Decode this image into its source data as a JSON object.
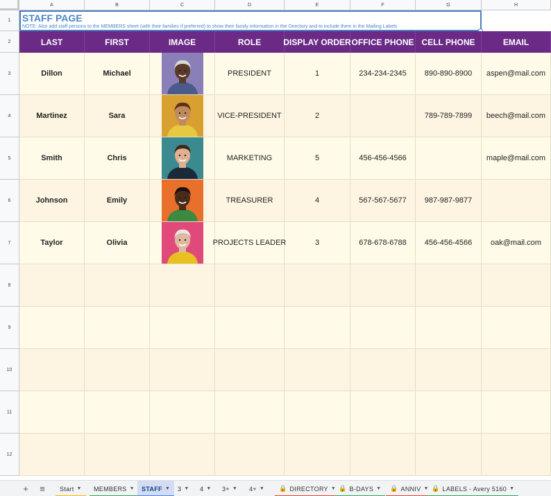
{
  "columns": [
    "A",
    "B",
    "C",
    "D",
    "E",
    "F",
    "G",
    "H"
  ],
  "rows": [
    "1",
    "2",
    "3",
    "4",
    "5",
    "6",
    "7",
    "8",
    "9",
    "10",
    "11",
    "12"
  ],
  "title": "STAFF PAGE",
  "note": "NOTE: Also add staff persons to the MEMBERS sheet (with their families if preferred) to show their family information in the Directory and to include them in the Mailing Labels",
  "headers": [
    "LAST",
    "FIRST",
    "IMAGE",
    "ROLE",
    "DISPLAY ORDER",
    "OFFICE PHONE",
    "CELL PHONE",
    "EMAIL"
  ],
  "staff": [
    {
      "last": "Dillon",
      "first": "Michael",
      "role": "PRESIDENT",
      "order": "1",
      "office": "234-234-2345",
      "cell": "890-890-8900",
      "email": "aspen@mail.com"
    },
    {
      "last": "Martinez",
      "first": "Sara",
      "role": "VICE-PRESIDENT",
      "order": "2",
      "office": "",
      "cell": "789-789-7899",
      "email": "beech@mail.com"
    },
    {
      "last": "Smith",
      "first": "Chris",
      "role": "MARKETING",
      "order": "5",
      "office": "456-456-4566",
      "cell": "",
      "email": "maple@mail.com"
    },
    {
      "last": "Johnson",
      "first": "Emily",
      "role": "TREASURER",
      "order": "4",
      "office": "567-567-5677",
      "cell": "987-987-9877",
      "email": ""
    },
    {
      "last": "Taylor",
      "first": "Olivia",
      "role": "PROJECTS LEADER",
      "order": "3",
      "office": "678-678-6788",
      "cell": "456-456-4566",
      "email": "oak@mail.com"
    }
  ],
  "photo_colors": [
    {
      "bg": "#8a7fb8",
      "skin": "#5a3a28",
      "hair": "#d8d8d8",
      "shirt": "#4a5a8a"
    },
    {
      "bg": "#d8a030",
      "skin": "#c08a60",
      "hair": "#5a3418",
      "shirt": "#e8c840"
    },
    {
      "bg": "#3a8a90",
      "skin": "#e0b090",
      "hair": "#3a2818",
      "shirt": "#1a2a3a"
    },
    {
      "bg": "#e8702a",
      "skin": "#4a2a18",
      "hair": "#1a1010",
      "shirt": "#3a8a40"
    },
    {
      "bg": "#e04a7a",
      "skin": "#e0b8a0",
      "hair": "#e8e8e8",
      "shirt": "#e8c020"
    }
  ],
  "tabs": [
    {
      "label": "Start",
      "locked": false,
      "color": "#ffb900"
    },
    {
      "label": "MEMBERS",
      "locked": false,
      "color": "#34a853"
    },
    {
      "label": "STAFF",
      "locked": false,
      "color": "#4285f4"
    },
    {
      "label": "3",
      "locked": false,
      "color": ""
    },
    {
      "label": "4",
      "locked": false,
      "color": ""
    },
    {
      "label": "3+",
      "locked": false,
      "color": ""
    },
    {
      "label": "4+",
      "locked": false,
      "color": ""
    },
    {
      "label": "DIRECTORY",
      "locked": true,
      "color": "#ea4335"
    },
    {
      "label": "B-DAYS",
      "locked": true,
      "color": "#34a853"
    },
    {
      "label": "ANNIV",
      "locked": true,
      "color": "#ea4335"
    },
    {
      "label": "LABELS - Avery 5160",
      "locked": true,
      "color": "#34a853"
    }
  ],
  "active_tab": "STAFF",
  "colors": {
    "header_bg": "#6a2a85",
    "title": "#4a86c5",
    "row_bg_a": "#fffbe8",
    "row_bg_b": "#fdf5e2"
  },
  "icons": {
    "add_sheet": "plus-icon",
    "all_sheets": "menu-icon",
    "dropdown": "caret-down-icon",
    "locked": "lock-icon"
  }
}
